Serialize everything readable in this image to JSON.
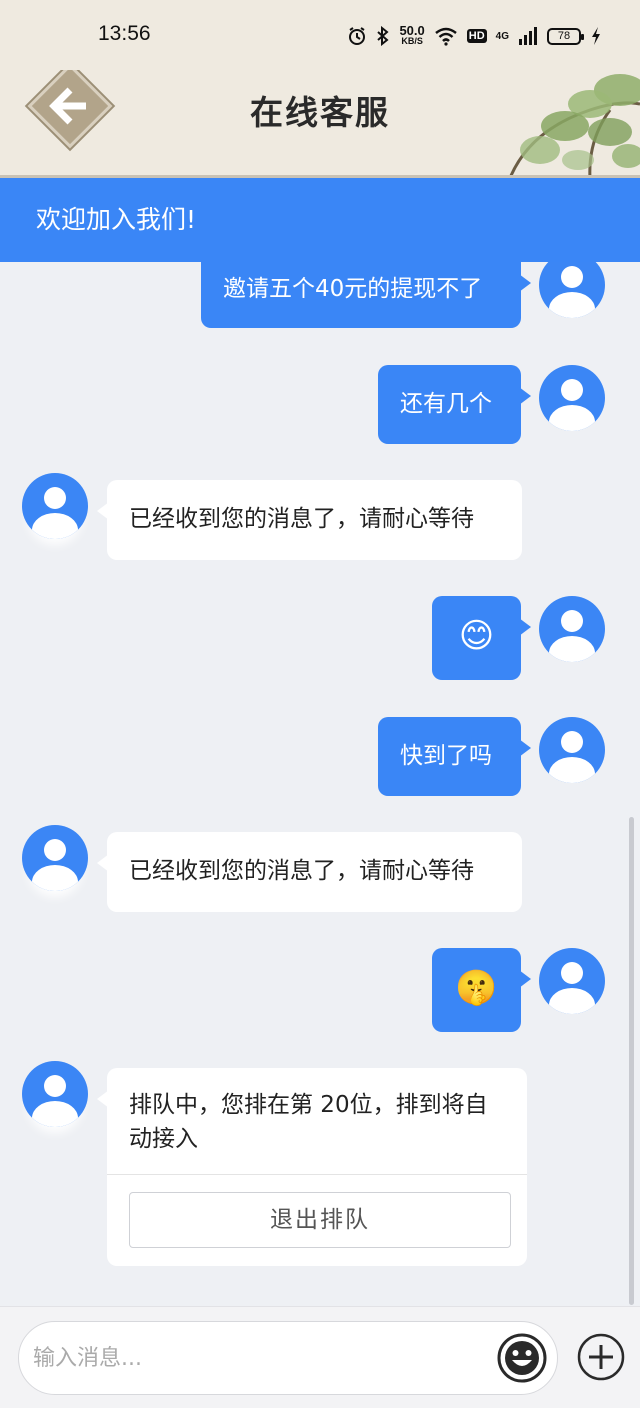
{
  "status_bar": {
    "time": "13:56",
    "net_speed_value": "50.0",
    "net_speed_unit": "KB/S",
    "hd": "HD",
    "network": "4G",
    "battery": "78",
    "icons": [
      "alarm-icon",
      "bluetooth-icon",
      "wifi-icon",
      "signal-icon",
      "charging-icon"
    ]
  },
  "header": {
    "title": "在线客服",
    "back_icon": "arrow-left-icon"
  },
  "banner": {
    "text": "欢迎加入我们!"
  },
  "messages": [
    {
      "from": "user",
      "text": "邀请五个40元的提现不了"
    },
    {
      "from": "user",
      "text": "还有几个"
    },
    {
      "from": "agent",
      "text": "已经收到您的消息了，请耐心等待"
    },
    {
      "from": "user",
      "emoji": "😊"
    },
    {
      "from": "user",
      "text": "快到了吗"
    },
    {
      "from": "agent",
      "text": "已经收到您的消息了，请耐心等待"
    },
    {
      "from": "user",
      "emoji": "🤫"
    },
    {
      "from": "agent",
      "text_line1": "排队中，您排在第 20位，排到将自",
      "text_line2": "动接入",
      "button": "退出排队"
    }
  ],
  "input": {
    "placeholder": "输入消息...",
    "emoji_icon": "smiley-icon",
    "plus_icon": "plus-icon"
  },
  "colors": {
    "accent": "#3a86f6",
    "header_bg": "#efeae0",
    "chat_bg": "#eef0f4"
  }
}
